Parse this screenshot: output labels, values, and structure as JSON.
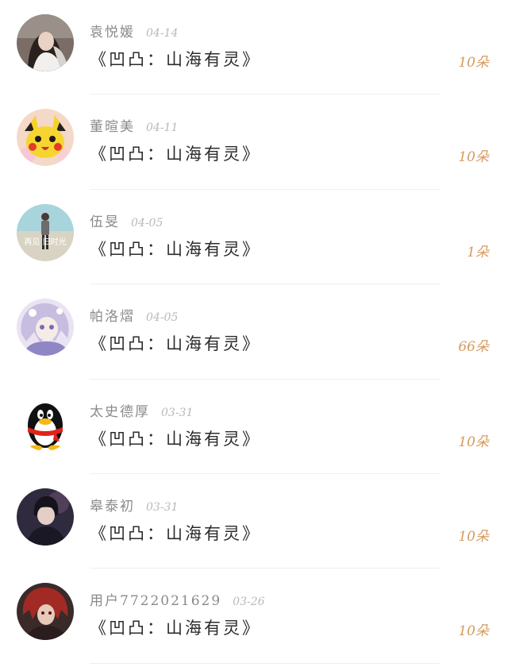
{
  "gifts": [
    {
      "user": "袁悦媛",
      "date": "04-14",
      "title": "《凹凸：山海有灵》",
      "count": "10朵",
      "avatar_icon": "girl-photo-avatar"
    },
    {
      "user": "董暄美",
      "date": "04-11",
      "title": "《凹凸：山海有灵》",
      "count": "10朵",
      "avatar_icon": "pikachu-avatar"
    },
    {
      "user": "伍旻",
      "date": "04-05",
      "title": "《凹凸：山海有灵》",
      "count": "1朵",
      "avatar_icon": "beach-person-avatar",
      "avatar_text": "再见 旧时光"
    },
    {
      "user": "帕洛熠",
      "date": "04-05",
      "title": "《凹凸：山海有灵》",
      "count": "66朵",
      "avatar_icon": "anime-character-avatar"
    },
    {
      "user": "太史德厚",
      "date": "03-31",
      "title": "《凹凸：山海有灵》",
      "count": "10朵",
      "avatar_icon": "qq-penguin-avatar"
    },
    {
      "user": "皋泰初",
      "date": "03-31",
      "title": "《凹凸：山海有灵》",
      "count": "10朵",
      "avatar_icon": "dark-anime-boy-avatar"
    },
    {
      "user": "用户7722021629",
      "date": "03-26",
      "title": "《凹凸：山海有灵》",
      "count": "10朵",
      "avatar_icon": "red-hair-anime-avatar"
    }
  ],
  "colors": {
    "name": "#8a8a8a",
    "date": "#b9b9b9",
    "title": "#2b2b2b",
    "count": "#d69a5d",
    "divider": "#efefef"
  }
}
